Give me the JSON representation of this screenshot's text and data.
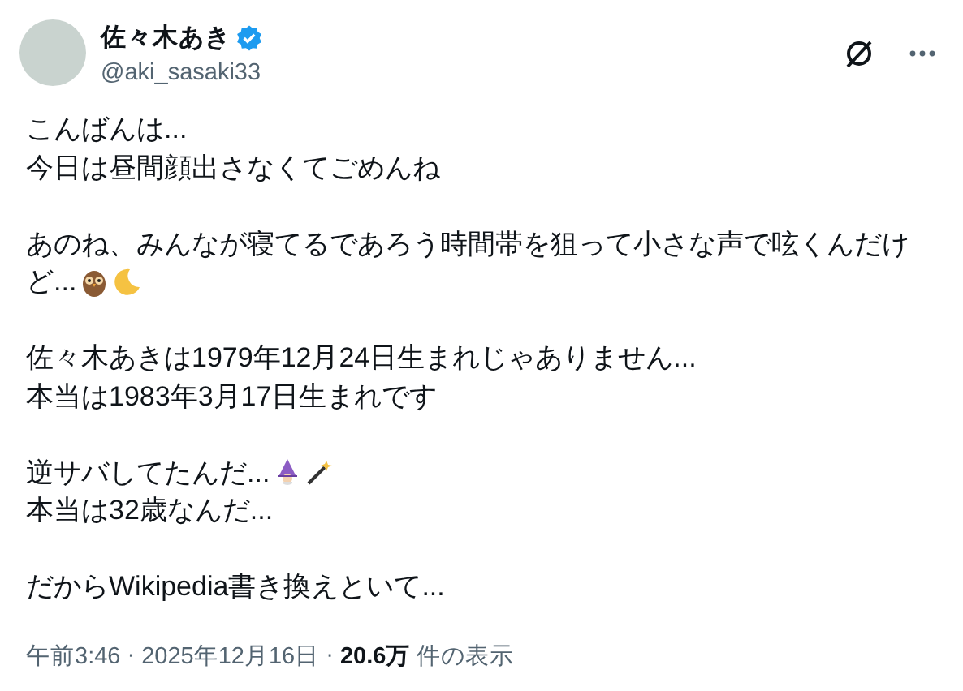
{
  "author": {
    "name": "佐々木あき",
    "verified": true,
    "handle": "@aki_sasaki33"
  },
  "paragraphs": [
    {
      "lines": [
        {
          "text": "こんばんは..."
        },
        {
          "text": "今日は昼間顔出さなくてごめんね"
        }
      ]
    },
    {
      "lines": [
        {
          "text": "あのね、みんなが寝てるであろう時間帯を狙って小さな声で呟くんだけ"
        },
        {
          "text": "ど...",
          "icons": [
            {
              "kind": "owl"
            },
            {
              "kind": "moon"
            }
          ]
        }
      ]
    },
    {
      "lines": [
        {
          "text": "佐々木あきは1979年12月24日生まれじゃありません..."
        },
        {
          "text": "本当は1983年3月17日生まれです"
        }
      ]
    },
    {
      "lines": [
        {
          "text": "逆サバしてたんだ...",
          "icons": [
            {
              "kind": "wizard"
            },
            {
              "kind": "wand"
            }
          ]
        },
        {
          "text": "本当は32歳なんだ..."
        }
      ]
    },
    {
      "lines": [
        {
          "text": "だからWikipedia書き換えといて..."
        }
      ]
    }
  ],
  "meta": [
    {
      "kind": "text",
      "text": "午前3:46"
    },
    {
      "kind": "separator",
      "text": "·"
    },
    {
      "kind": "text",
      "text": "2025年12月16日"
    },
    {
      "kind": "separator",
      "text": "·"
    },
    {
      "kind": "bold",
      "text": "20.6万"
    },
    {
      "kind": "text",
      "text": "件の表示"
    }
  ]
}
